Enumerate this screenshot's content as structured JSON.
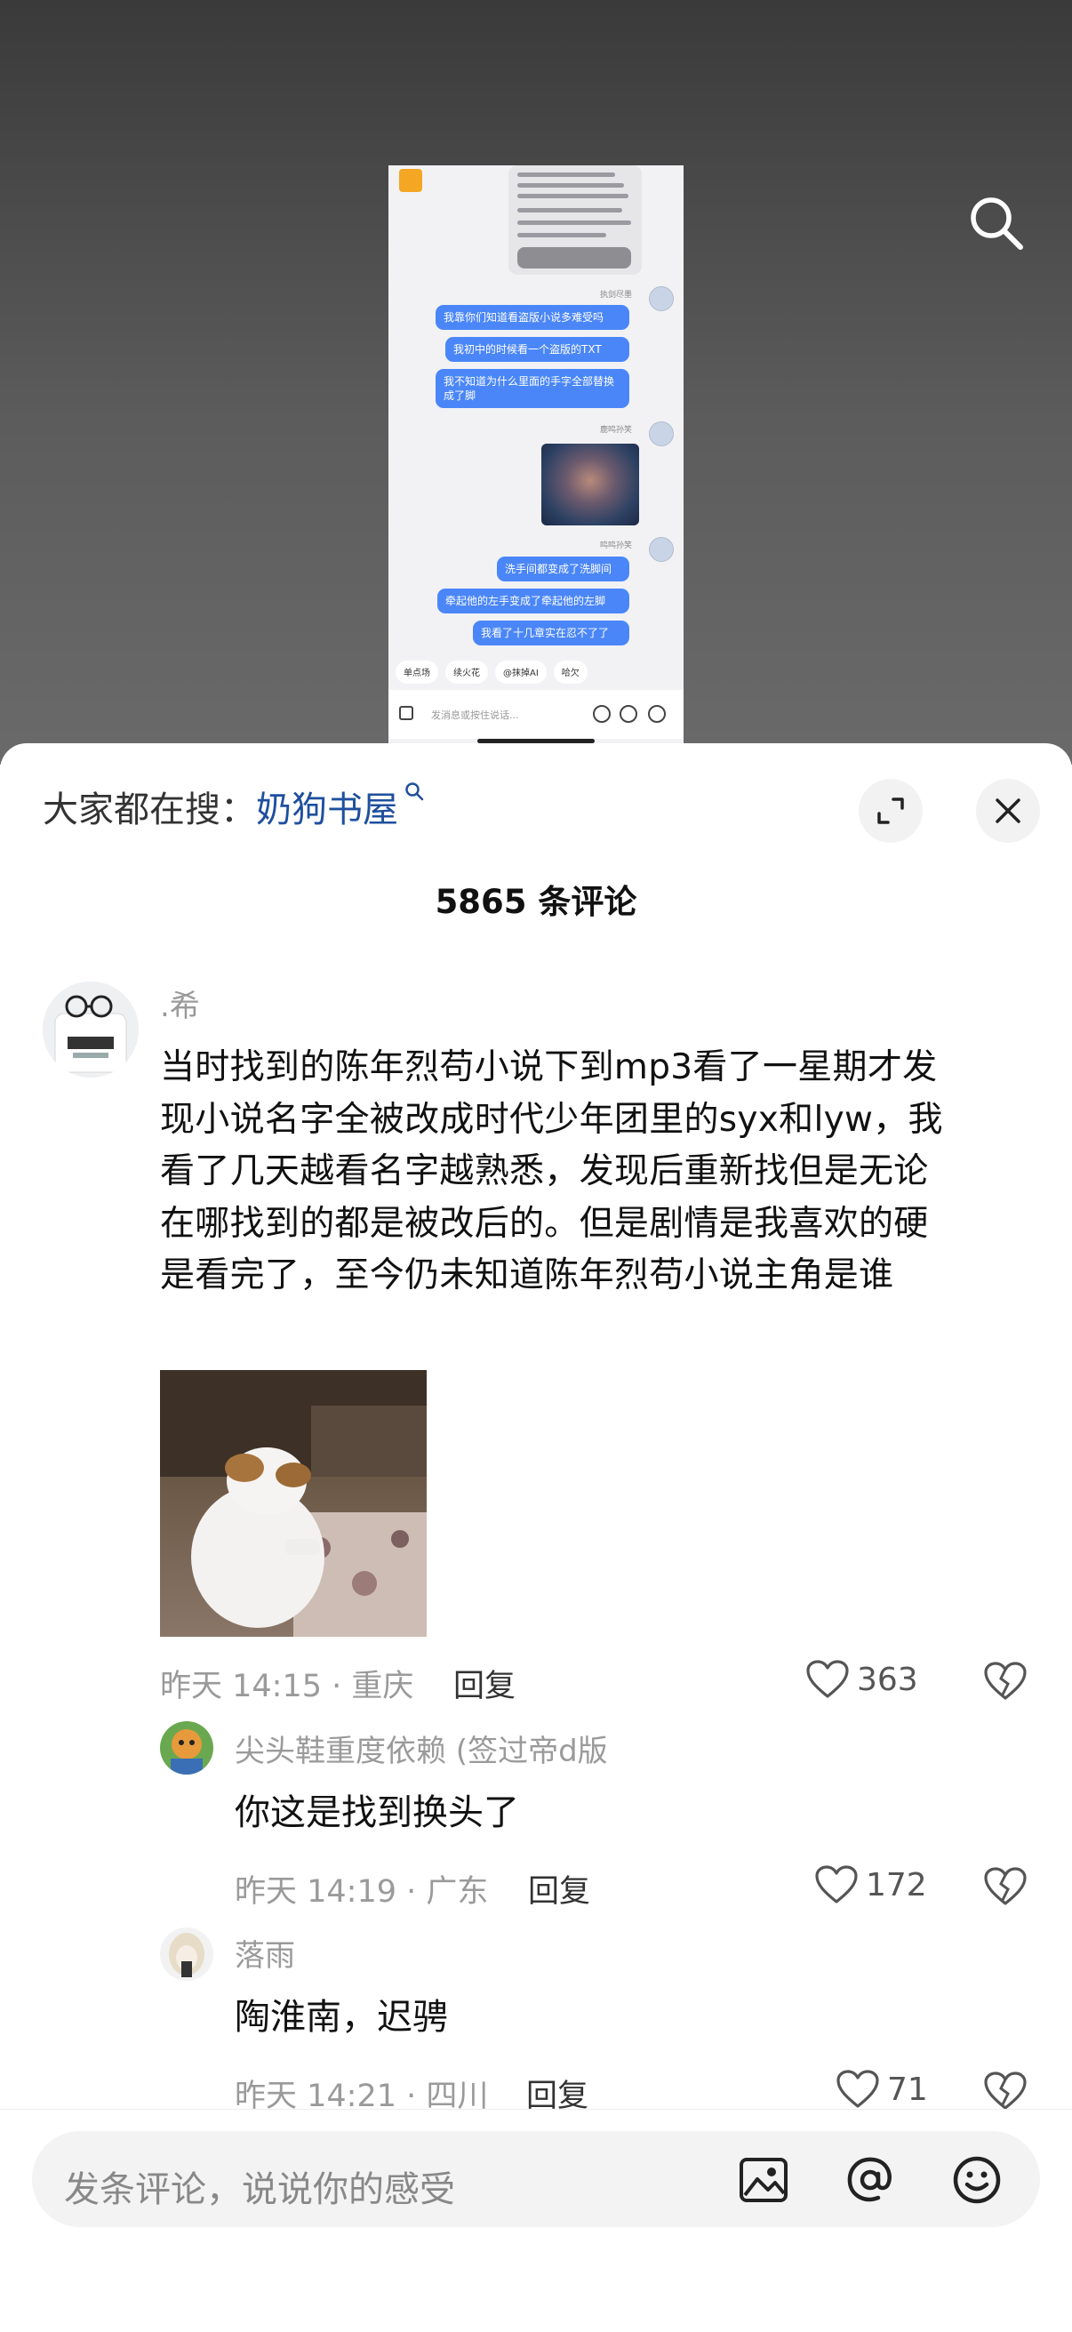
{
  "video": {
    "chat": {
      "mini_names": [
        "执剑尽墨",
        "鹿鸣孙笑",
        "鸣鸣孙笑"
      ],
      "messages": [
        "我靠你们知道看盗版小说多难受吗",
        "我初中的时候看一个盗版的TXT",
        "我不知道为什么里面的手字全部替换成了脚",
        "洗手间都变成了洗脚间",
        "牵起他的左手变成了牵起他的左脚",
        "我看了十几章实在忍不了了"
      ],
      "chips": [
        "单点场",
        "续火花",
        "@抹掉AI",
        "哈欠"
      ],
      "input_placeholder": "发消息或按住说话..."
    }
  },
  "trending": {
    "prefix": "大家都在搜：",
    "keyword": "奶狗书屋"
  },
  "comments_count": "5865 条评论",
  "main_comment": {
    "username": ".希",
    "text_lines": [
      "当时找到的陈年烈苟小说下到mp3看了一星期才发",
      "现小说名字全被改成时代少年团里的syx和lyw，我",
      "看了几天越看名字越熟悉，发现后重新找但是无论",
      "在哪找到的都是被改后的。但是剧情是我喜欢的硬",
      "是看完了，至今仍未知道陈年烈苟小说主角是谁"
    ],
    "meta": "昨天 14:15 · 重庆",
    "reply_label": "回复",
    "likes": "363"
  },
  "replies": [
    {
      "username": "尖头鞋重度依赖 (签过帝d版",
      "text": "你这是找到换头了",
      "meta": "昨天 14:19 · 广东",
      "reply_label": "回复",
      "likes": "172"
    },
    {
      "username": "落雨",
      "text": "陶淮南，迟骋",
      "meta": "昨天 14:21 · 四川",
      "reply_label": "回复",
      "likes": "71"
    }
  ],
  "bottom_bar": {
    "placeholder": "发条评论，说说你的感受"
  },
  "colors": {
    "keyword": "#1f4f9e",
    "chat_bubble": "#4a86f7",
    "meta_gray": "#9a9a9a"
  }
}
